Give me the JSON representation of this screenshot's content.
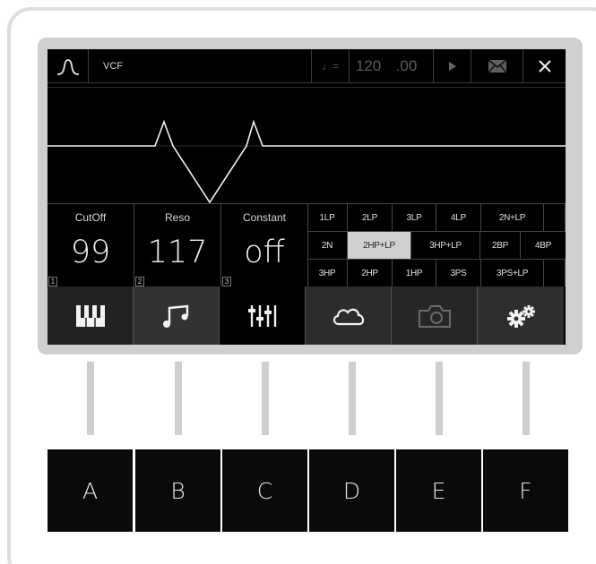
{
  "header": {
    "module_name": "VCF",
    "tempo_symbol": "♩=",
    "tempo_value": "120",
    "tempo_fraction": ".00"
  },
  "params": [
    {
      "label": "CutOff",
      "value": "99",
      "index": "1"
    },
    {
      "label": "Reso",
      "value": "117",
      "index": "2"
    },
    {
      "label": "Constant",
      "value": "off",
      "index": "3"
    }
  ],
  "filters": {
    "row1": [
      "1LP",
      "2LP",
      "3LP",
      "4LP",
      "2N+LP",
      ""
    ],
    "row2": [
      "2N",
      "2HP+LP",
      "3HP+LP",
      "2BP",
      "4BP"
    ],
    "row3": [
      "3HP",
      "2HP",
      "1HP",
      "3PS",
      "3PS+LP",
      ""
    ],
    "selected": "2HP+LP"
  },
  "icons": [
    "piano-keys-icon",
    "music-note-icon",
    "mixer-sliders-icon",
    "cloud-icon",
    "camera-icon",
    "gears-icon"
  ],
  "hardware_buttons": [
    "A",
    "B",
    "C",
    "D",
    "E",
    "F"
  ],
  "colors": {
    "screen_bg": "#000000",
    "selected_filter_bg": "#d0d0d0",
    "bezel": "#cfcfcf"
  }
}
